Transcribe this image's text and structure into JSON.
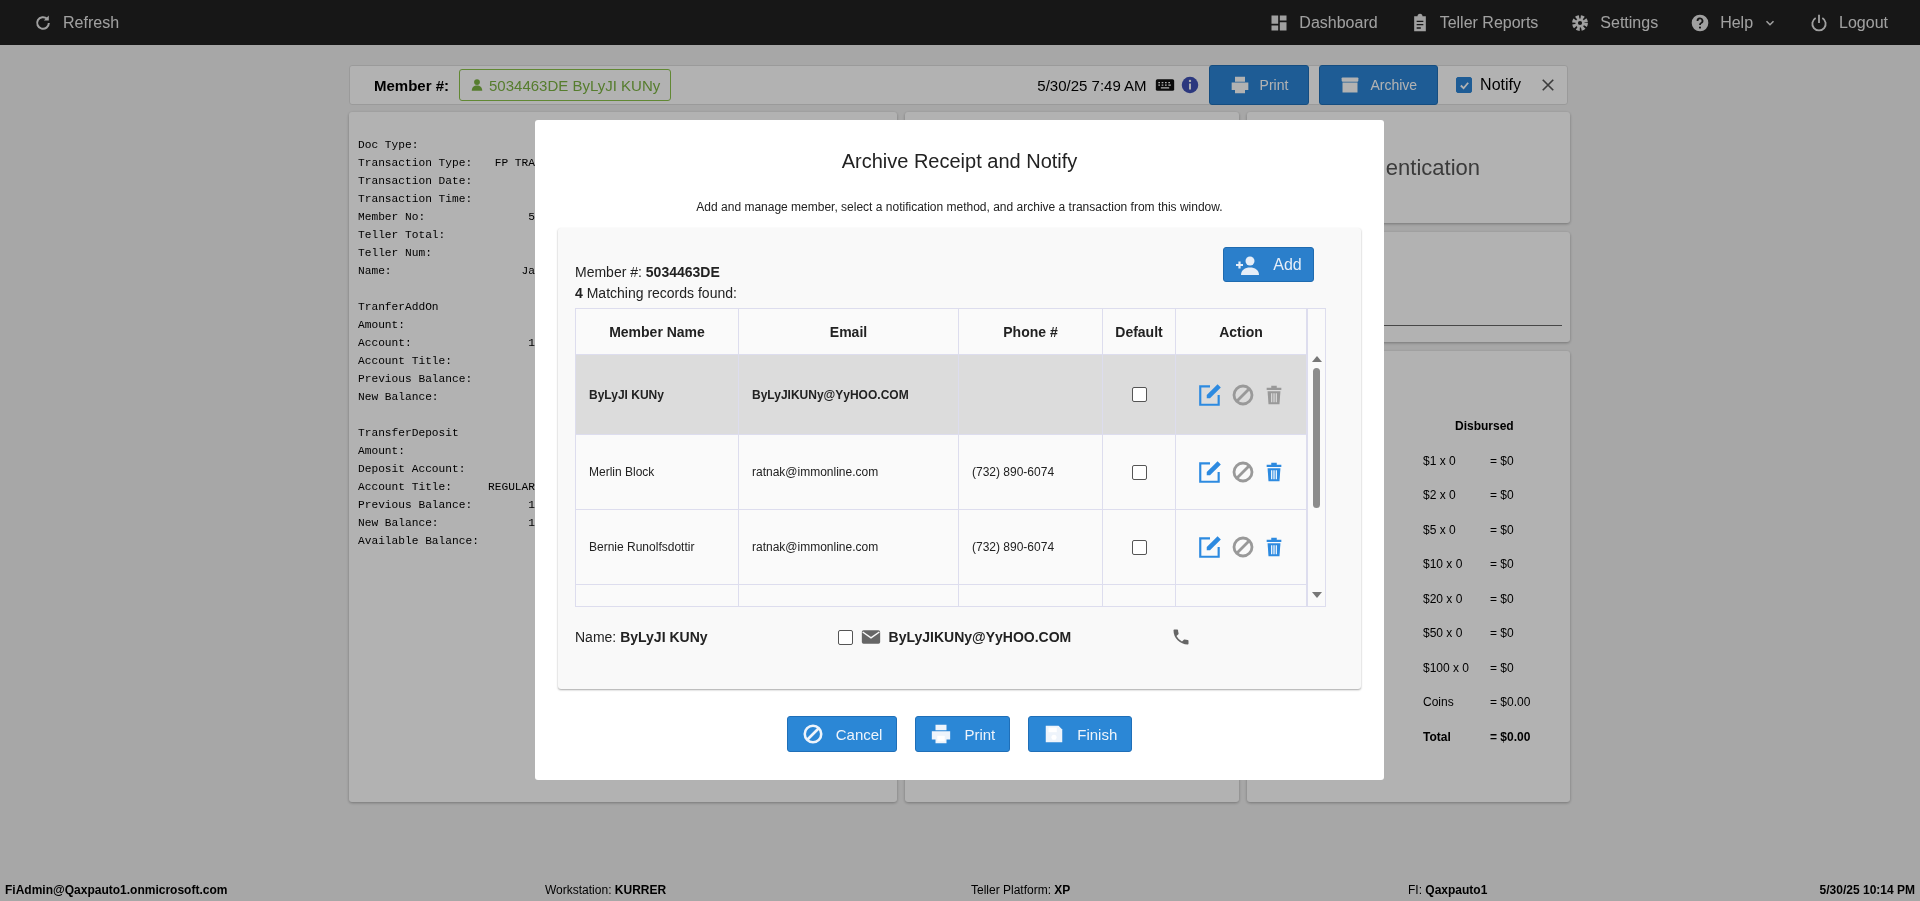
{
  "nav": {
    "left": [
      {
        "kind": "refresh",
        "label": "Refresh"
      }
    ],
    "right": [
      {
        "kind": "dashboard",
        "label": "Dashboard",
        "menu": false
      },
      {
        "kind": "reports",
        "label": "Teller Reports",
        "menu": false
      },
      {
        "kind": "settings",
        "label": "Settings",
        "menu": false
      },
      {
        "kind": "help",
        "label": "Help",
        "menu": true
      },
      {
        "kind": "logout",
        "label": "Logout",
        "menu": false
      }
    ]
  },
  "header": {
    "member_label": "Member #:",
    "member_value": "5034463DE ByLyJI KUNy",
    "datetime": "5/30/25 7:49 AM",
    "buttons": [
      {
        "kind": "print",
        "label": "Print"
      },
      {
        "kind": "archive",
        "label": "Archive"
      }
    ],
    "notify": {
      "label": "Notify",
      "checked": true
    }
  },
  "receipt": {
    "groups": [
      [
        {
          "label": "Doc Type:"
        },
        {
          "label": "Transaction Type:",
          "value": "FP TRA"
        },
        {
          "label": "Transaction Date:"
        },
        {
          "label": "Transaction Time:"
        },
        {
          "label": "Member No:",
          "value": "5"
        },
        {
          "label": "Teller Total:"
        },
        {
          "label": "Teller Num:"
        },
        {
          "label": "Name:",
          "value": "Ja"
        }
      ],
      [
        {
          "label": "TranferAddOn"
        },
        {
          "label": "Amount:"
        },
        {
          "label": "Account:",
          "value": "1"
        },
        {
          "label": "Account Title:"
        },
        {
          "label": "Previous Balance:"
        },
        {
          "label": "New Balance:"
        }
      ],
      [
        {
          "label": "TransferDeposit"
        },
        {
          "label": "Amount:"
        },
        {
          "label": "Deposit Account:"
        },
        {
          "label": "Account Title:",
          "value": "REGULAR"
        },
        {
          "label": "Previous Balance:",
          "value": "1"
        },
        {
          "label": "New Balance:",
          "value": "1"
        },
        {
          "label": "Available Balance:"
        }
      ]
    ]
  },
  "auth_panel": {
    "title": "entication"
  },
  "disbursed": {
    "title": "Disbursed",
    "rows": [
      {
        "kind": "line",
        "denomination": "$1 x 0",
        "amount": "= $0"
      },
      {
        "kind": "line",
        "denomination": "$2 x 0",
        "amount": "= $0"
      },
      {
        "kind": "line",
        "denomination": "$5 x 0",
        "amount": "= $0"
      },
      {
        "kind": "line",
        "denomination": "$10 x 0",
        "amount": "= $0"
      },
      {
        "kind": "line",
        "denomination": "$20 x 0",
        "amount": "= $0"
      },
      {
        "kind": "line",
        "denomination": "$50 x 0",
        "amount": "= $0"
      },
      {
        "kind": "line",
        "denomination": "$100 x 0",
        "amount": "= $0"
      },
      {
        "kind": "line",
        "denomination": "Coins",
        "amount": "= $0.00"
      },
      {
        "kind": "total",
        "denomination": "Total",
        "amount": "= $0.00"
      }
    ]
  },
  "modal": {
    "title": "Archive Receipt and Notify",
    "subtitle": "Add and manage member, select a notification method, and archive a transaction from this window.",
    "member_label": "Member #:",
    "member_value": "5034463DE",
    "count": "4",
    "count_text": "Matching records found:",
    "add_button": "Add",
    "columns": [
      "Member Name",
      "Email",
      "Phone #",
      "Default",
      "Action"
    ],
    "rows": [
      {
        "name": "ByLyJI KUNy",
        "email": "ByLyJIKUNy@YyHOO.COM",
        "default": false,
        "selected": true,
        "delete_disabled": true
      },
      {
        "name": "Merlin Block",
        "email": "ratnak@immonline.com",
        "phone": "(732) 890-6074",
        "default": false,
        "selected": false,
        "delete_disabled": false
      },
      {
        "name": "Bernie Runolfsdottir",
        "email": "ratnak@immonline.com",
        "phone": "(732) 890-6074",
        "default": false,
        "selected": false,
        "delete_disabled": false
      }
    ],
    "footer": {
      "name_label": "Name:",
      "name": "ByLyJI KUNy",
      "email_checked": false,
      "email": "ByLyJIKUNy@YyHOO.COM"
    },
    "buttons": [
      {
        "kind": "cancel",
        "label": "Cancel"
      },
      {
        "kind": "print",
        "label": "Print"
      },
      {
        "kind": "finish",
        "label": "Finish"
      }
    ]
  },
  "status_bar": [
    {
      "value": "FiAdmin@Qaxpauto1.onmicrosoft.com"
    },
    {
      "label": "Workstation:",
      "value": "KURRER"
    },
    {
      "label": "Teller Platform:",
      "value": "XP"
    },
    {
      "label": "FI:",
      "value": "Qaxpauto1"
    },
    {
      "value": "5/30/25 10:14 PM"
    }
  ]
}
